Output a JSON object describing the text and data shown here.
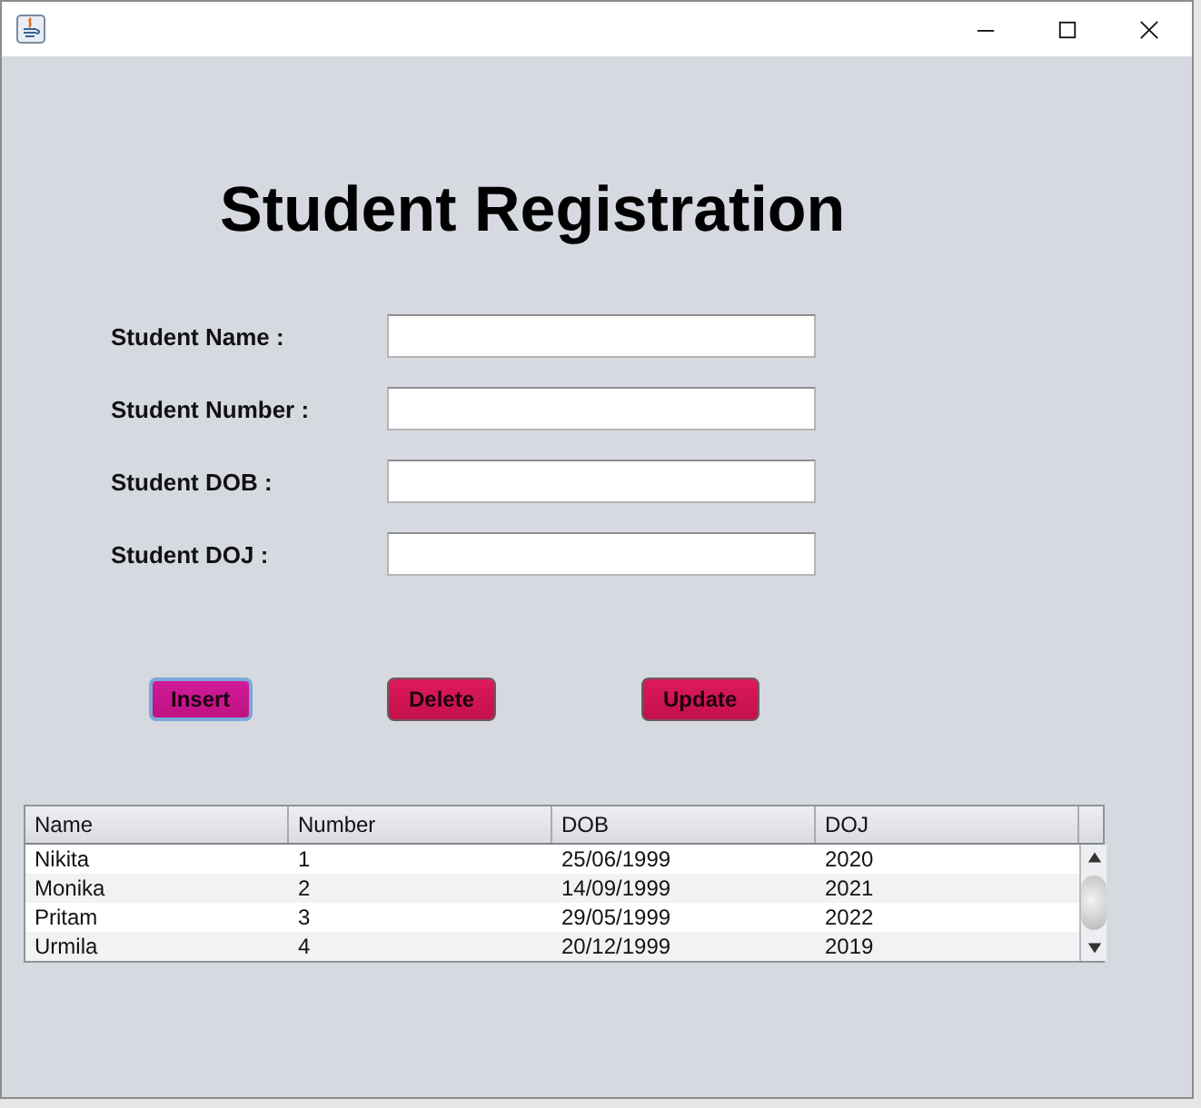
{
  "title": "Student Registration",
  "fields": [
    {
      "label": "Student Name :"
    },
    {
      "label": "Student Number :"
    },
    {
      "label": "Student DOB :"
    },
    {
      "label": "Student DOJ :"
    }
  ],
  "buttons": [
    {
      "label": "Insert",
      "focused": true
    },
    {
      "label": "Delete",
      "focused": false
    },
    {
      "label": "Update",
      "focused": false
    }
  ],
  "table": {
    "columns": [
      "Name",
      "Number",
      "DOB",
      "DOJ"
    ],
    "rows": [
      [
        "Nikita",
        "1",
        "25/06/1999",
        "2020"
      ],
      [
        "Monika",
        "2",
        "14/09/1999",
        "2021"
      ],
      [
        "Pritam",
        "3",
        "29/05/1999",
        "2022"
      ],
      [
        "Urmila",
        "4",
        "20/12/1999",
        "2019"
      ]
    ]
  }
}
